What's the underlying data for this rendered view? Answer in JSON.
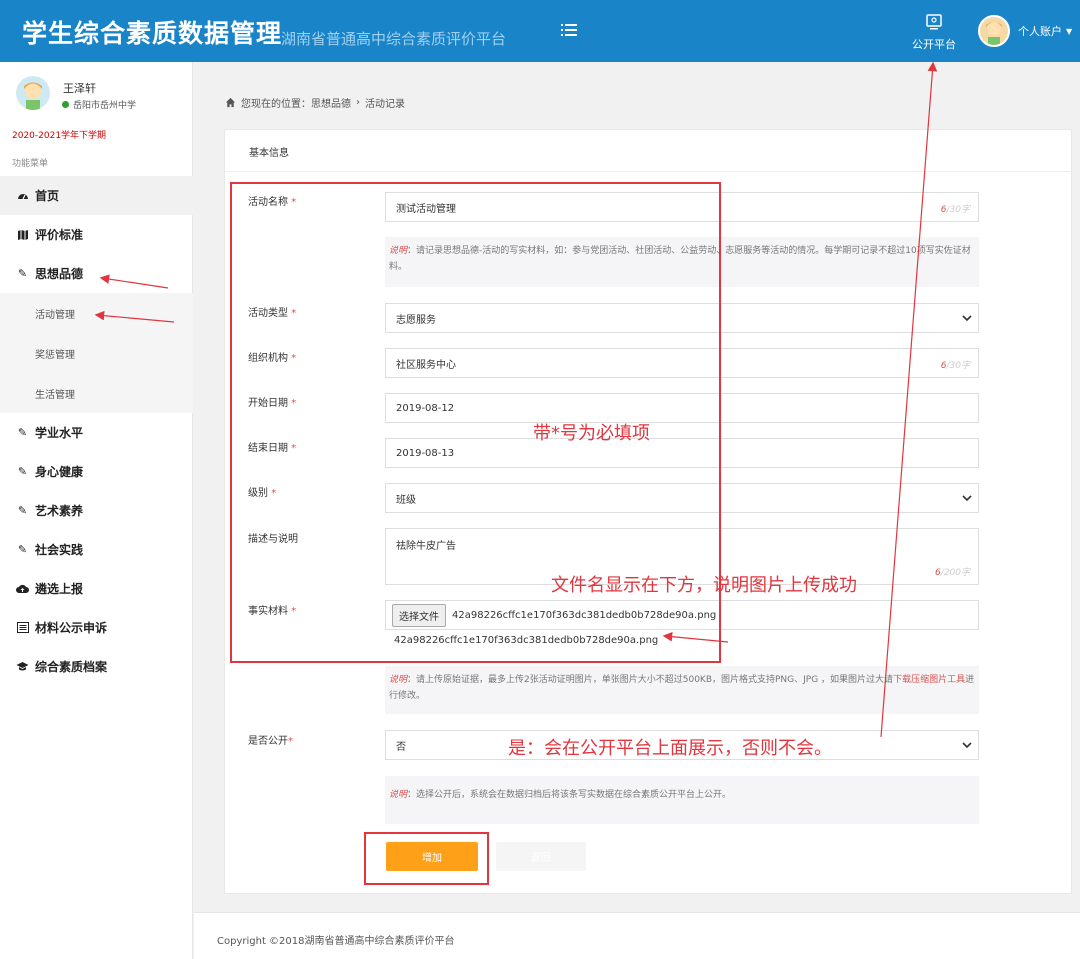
{
  "header": {
    "title": "学生综合素质数据管理",
    "subtitle": "湖南省普通高中综合素质评价平台",
    "public_label": "公开平台",
    "account_label": "个人账户"
  },
  "sidebar": {
    "user_name": "王泽轩",
    "school": "岳阳市岳州中学",
    "term": "2020-2021学年下学期",
    "menu_title": "功能菜单",
    "items": [
      {
        "label": "首页",
        "icon": "dashboard-icon"
      },
      {
        "label": "评价标准",
        "icon": "map-icon"
      },
      {
        "label": "思想品德",
        "icon": "edit-icon"
      },
      {
        "label": "学业水平",
        "icon": "edit-icon"
      },
      {
        "label": "身心健康",
        "icon": "edit-icon"
      },
      {
        "label": "艺术素养",
        "icon": "edit-icon"
      },
      {
        "label": "社会实践",
        "icon": "edit-icon"
      },
      {
        "label": "遴选上报",
        "icon": "cloud-upload-icon"
      },
      {
        "label": "材料公示申诉",
        "icon": "list-icon"
      },
      {
        "label": "综合素质档案",
        "icon": "graduation-cap-icon"
      }
    ],
    "sub_items": [
      "活动管理",
      "奖惩管理",
      "生活管理"
    ]
  },
  "breadcrumb": {
    "prefix": "您现在的位置：思想品德",
    "sep": "›",
    "current": "活动记录"
  },
  "form": {
    "section_title": "基本信息",
    "req_mark": "*",
    "activity_name": {
      "label": "活动名称",
      "value": "测试活动管理",
      "count": "6",
      "max": "/30字"
    },
    "name_note_tag": "说明",
    "name_note": "：请记录思想品德-活动的写实材料，如：参与党团活动、社团活动、公益劳动、志愿服务等活动的情况。每学期可记录不超过10项写实佐证材料。",
    "activity_type": {
      "label": "活动类型",
      "value": "志愿服务"
    },
    "organization": {
      "label": "组织机构",
      "value": "社区服务中心",
      "count": "6",
      "max": "/30字"
    },
    "start_date": {
      "label": "开始日期",
      "value": "2019-08-12"
    },
    "end_date": {
      "label": "结束日期",
      "value": "2019-08-13"
    },
    "level": {
      "label": "级别",
      "value": "班级"
    },
    "description": {
      "label": "描述与说明",
      "value": "祛除牛皮广告",
      "count": "6",
      "max": "/200字"
    },
    "evidence": {
      "label": "事实材料",
      "button": "选择文件",
      "filename": "42a98226cffc1e170f363dc381dedb0b728de90a.png",
      "filename_below": "42a98226cffc1e170f363dc381dedb0b728de90a.png"
    },
    "upload_note_tag": "说明",
    "upload_note": "：请上传原始证据，最多上传2张活动证明图片，单张图片大小不超过500KB，图片格式支持PNG、JPG ，如果图片过大请",
    "upload_note_link": "下载压缩图片工具",
    "upload_note_tail": "进行修改。",
    "is_public": {
      "label": "是否公开",
      "value": "否"
    },
    "public_note_tag": "说明",
    "public_note": "：选择公开后，系统会在数据归档后将该条写实数据在综合素质公开平台上公开。",
    "add_button": "增加",
    "back_button": "返回"
  },
  "footer": {
    "copyright": "Copyright ©2018湖南省普通高中综合素质评价平台"
  },
  "annotations": {
    "required": "带*号为必填项",
    "upload_success": "文件名显示在下方，说明图片上传成功",
    "public": "是：会在公开平台上面展示，否则不会。"
  },
  "colors": {
    "header": "#1a84c9",
    "accent": "#ffa019",
    "annotation": "#e2353d"
  }
}
